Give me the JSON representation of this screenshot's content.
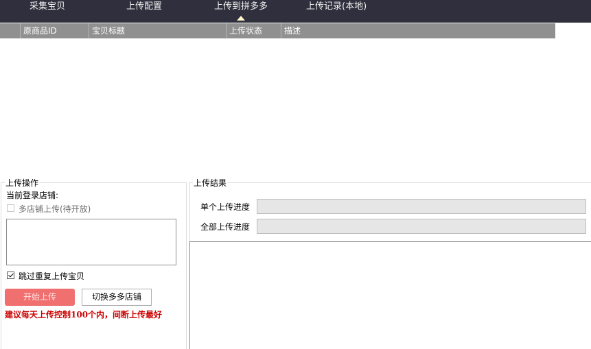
{
  "nav": {
    "tabs": [
      {
        "label": "采集宝贝",
        "active": false
      },
      {
        "label": "上传配置",
        "active": false
      },
      {
        "label": "上传到拼多多",
        "active": true
      },
      {
        "label": "上传记录(本地)",
        "active": false
      }
    ]
  },
  "table": {
    "columns": [
      "",
      "原商品ID",
      "宝贝标题",
      "上传状态",
      "描述"
    ],
    "rows": []
  },
  "upload_ops": {
    "title": "上传操作",
    "current_shop_label": "当前登录店铺:",
    "multi_shop_label": "多店铺上传(待开放)",
    "multi_shop_checked": false,
    "multi_shop_enabled": false,
    "skip_duplicate_label": "跳过重复上传宝贝",
    "skip_duplicate_checked": true,
    "start_button": "开始上传",
    "switch_button": "切换多多店铺",
    "warning": "建议每天上传控制100个内，间断上传最好",
    "colors": {
      "start_button": "#f07070",
      "warning": "#cc0000"
    }
  },
  "upload_result": {
    "title": "上传结果",
    "single_progress_label": "单个上传进度",
    "single_progress": 0,
    "all_progress_label": "全部上传进度",
    "all_progress": 0
  }
}
